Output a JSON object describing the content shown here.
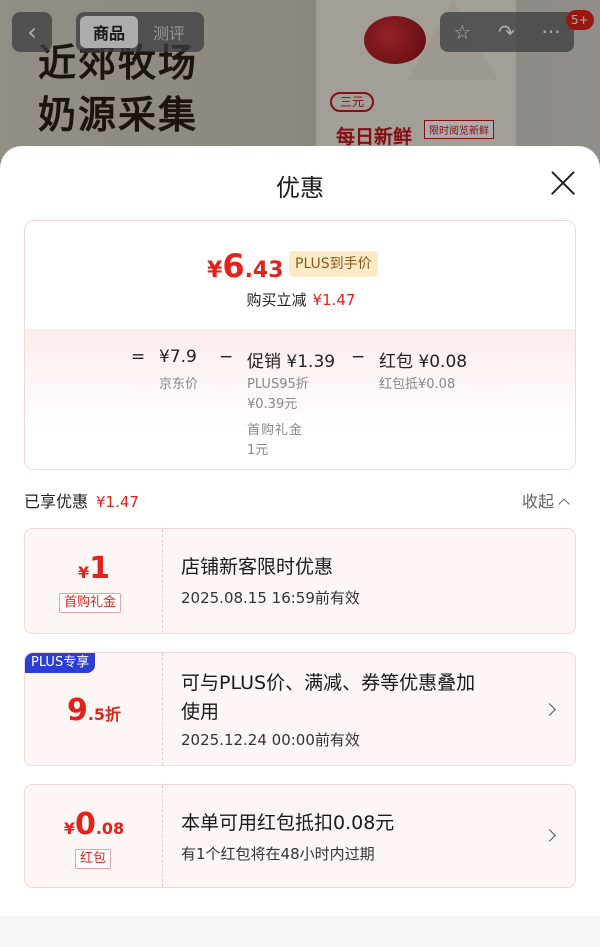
{
  "background": {
    "headline_line1": "近郊牧场",
    "headline_line2": "奶源采集",
    "brand_logo": "三元",
    "brand_text": "每日新鲜",
    "brand_tag": "限时阅览新鲜",
    "tabs": [
      {
        "label": "商品",
        "active": true
      },
      {
        "label": "测评",
        "active": false
      }
    ],
    "badge": "5+",
    "icons": [
      "back-icon",
      "star-icon",
      "share-icon",
      "more-icon"
    ]
  },
  "sheet": {
    "title": "优惠",
    "price_card": {
      "price_yen": "¥",
      "price_int": "6",
      "price_dec": ".43",
      "plus_label": "PLUS到手价",
      "buy_cut_label": "购买立减",
      "buy_cut_amount": "¥1.47",
      "eq": "=",
      "minus1": "−",
      "minus2": "−",
      "jd_price": "¥7.9",
      "jd_label": "京东价",
      "promo_label": "促销",
      "promo_amount": "¥1.39",
      "promo_sub1": "PLUS95折",
      "promo_sub2": "¥0.39元",
      "promo_sub3": "首购礼金",
      "promo_sub4": "1元",
      "redpack_label": "红包",
      "redpack_amount": "¥0.08",
      "redpack_sub": "红包抵¥0.08"
    },
    "enjoyed_label": "已享优惠",
    "enjoyed_amount": "¥1.47",
    "collapse_label": "收起",
    "offers": [
      {
        "amount_prefix": "¥",
        "amount_main": "1",
        "amount_suffix": "",
        "tag": "首购礼金",
        "title": "店铺新客限时优惠",
        "desc": "2025.08.15 16:59前有效"
      },
      {
        "flag": "PLUS专享",
        "amount_main": "9",
        "amount_suffix": ".5折",
        "title_line1": "可与PLUS价、满减、券等优惠叠加",
        "title_line2": "使用",
        "desc": "2025.12.24 00:00前有效"
      },
      {
        "amount_prefix": "¥",
        "amount_main": "0",
        "amount_suffix": ".08",
        "tag": "红包",
        "title": "本单可用红包抵扣0.08元",
        "desc": "有1个红包将在48小时内过期"
      }
    ]
  },
  "colors": {
    "accent_red": "#e2231a",
    "plus_blue": "#2b3fd6",
    "plus_gold_bg": "#fdebc8"
  }
}
